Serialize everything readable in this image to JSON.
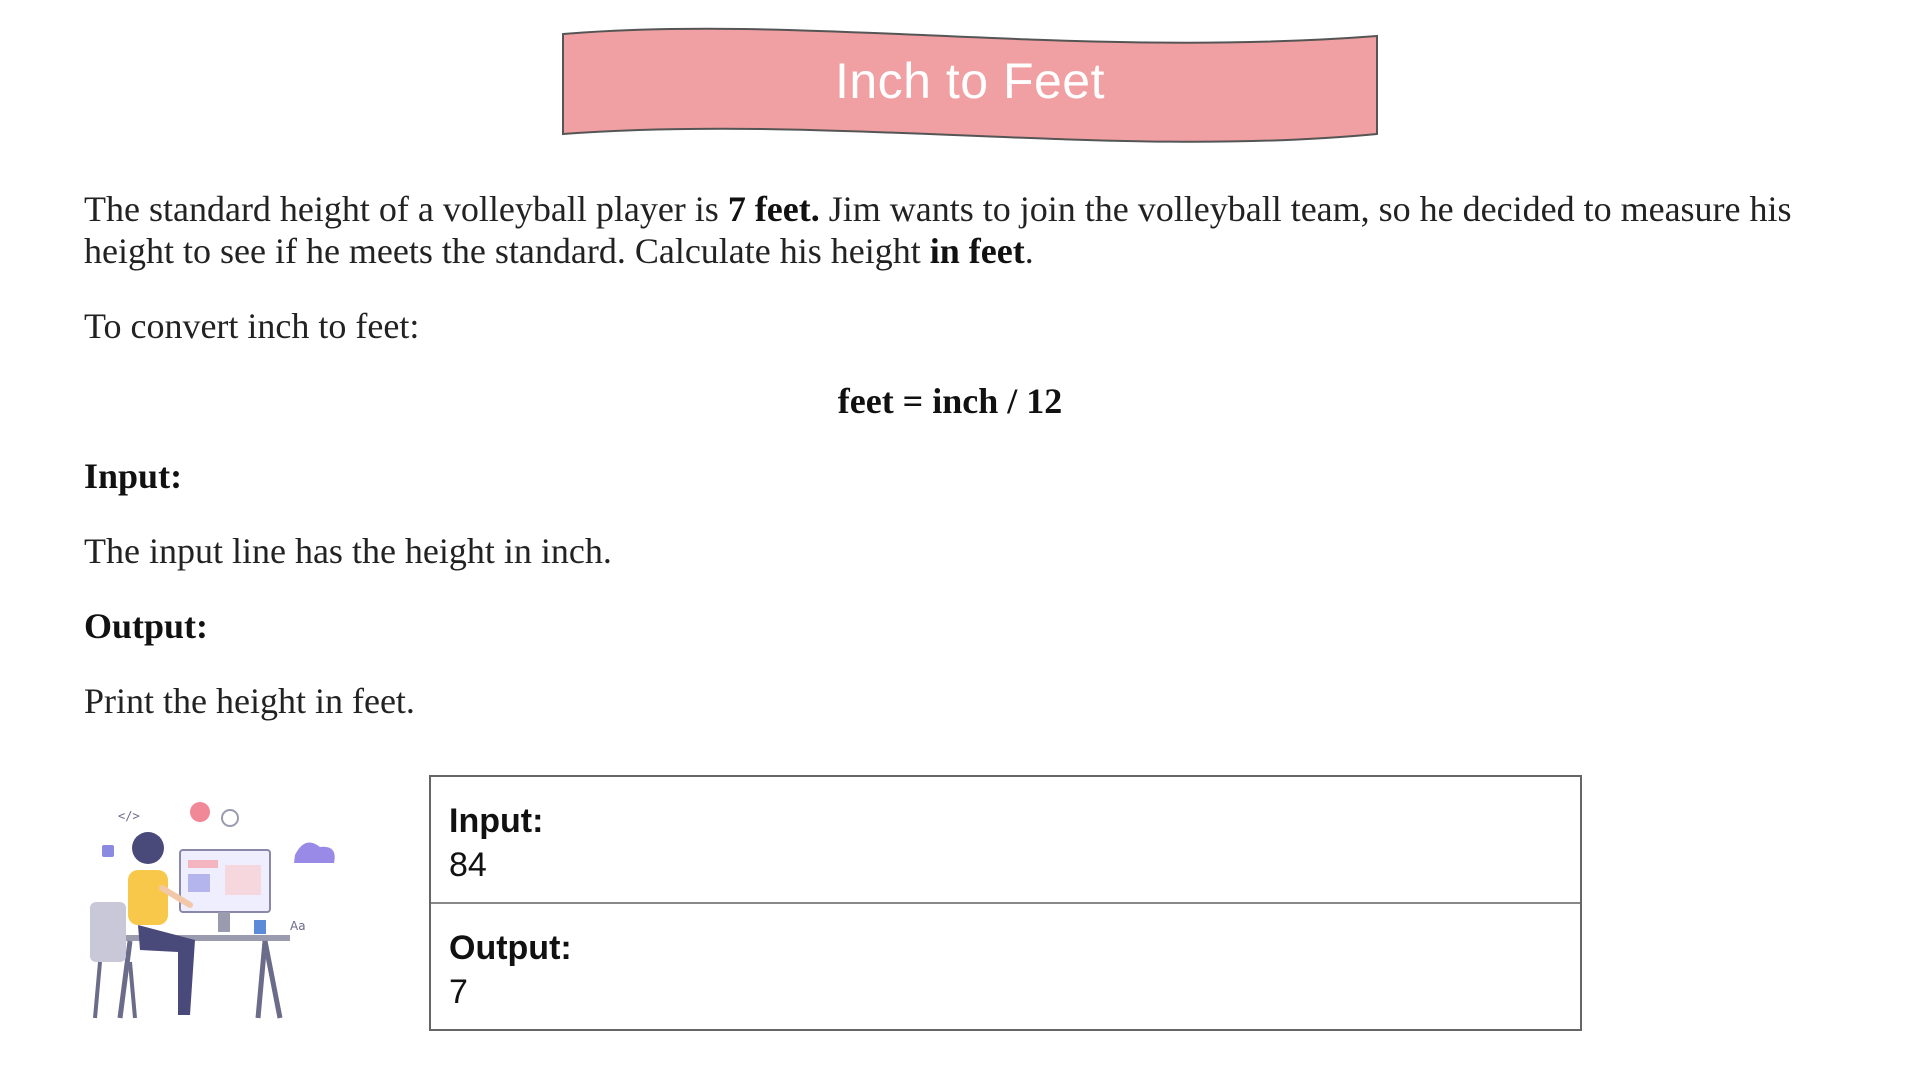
{
  "banner": {
    "title": "Inch to Feet",
    "color": "#f0a0a2"
  },
  "intro": {
    "part1": "The standard height of a volleyball player is ",
    "bold1": "7 feet.",
    "part2": " Jim wants to join the volleyball team, so he decided to measure his height to see if he meets the standard. Calculate his height ",
    "bold2": "in feet",
    "part3": "."
  },
  "convert_line": "To convert inch to feet:",
  "formula": "feet = inch / 12",
  "input_section": {
    "heading": "Input:",
    "description": "The input line has the height in inch."
  },
  "output_section": {
    "heading": "Output:",
    "description": "Print the height in feet."
  },
  "illustration": {
    "icon": "person-at-computer-illustration"
  },
  "sample": {
    "input_label": "Input:",
    "input_value": "84",
    "output_label": "Output:",
    "output_value": "7"
  }
}
